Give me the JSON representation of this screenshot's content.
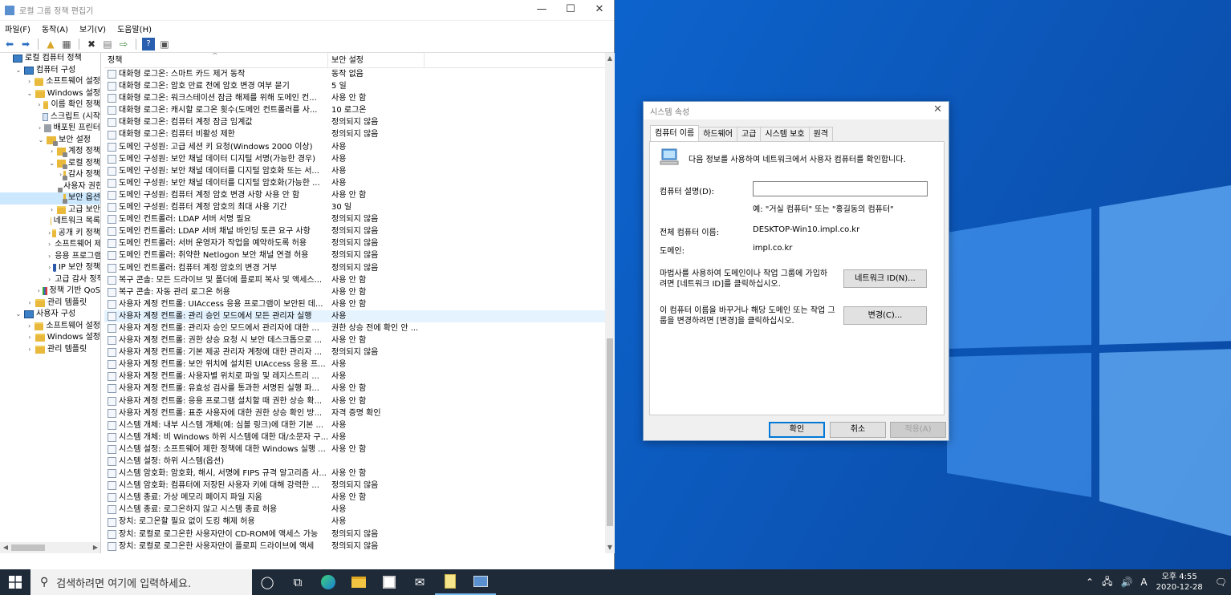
{
  "gpo": {
    "title": "로컬 그룹 정책 편집기",
    "menu": [
      "파일(F)",
      "동작(A)",
      "보기(V)",
      "도움말(H)"
    ],
    "tree": [
      {
        "label": "로컬 컴퓨터 정책",
        "level": 0,
        "exp": "",
        "icon": "pc"
      },
      {
        "label": "컴퓨터 구성",
        "level": 1,
        "exp": "⌄",
        "icon": "pc"
      },
      {
        "label": "소프트웨어 설정",
        "level": 2,
        "exp": "›",
        "icon": "folder"
      },
      {
        "label": "Windows 설정",
        "level": 2,
        "exp": "⌄",
        "icon": "folder"
      },
      {
        "label": "이름 확인 정책",
        "level": 3,
        "exp": "›",
        "icon": "folder"
      },
      {
        "label": "스크립트 (시작",
        "level": 3,
        "exp": "",
        "icon": "script"
      },
      {
        "label": "배포된 프린터",
        "level": 3,
        "exp": "›",
        "icon": "printer"
      },
      {
        "label": "보안 설정",
        "level": 3,
        "exp": "⌄",
        "icon": "sec"
      },
      {
        "label": "계정 정책",
        "level": 4,
        "exp": "›",
        "icon": "sec"
      },
      {
        "label": "로컬 정책",
        "level": 4,
        "exp": "⌄",
        "icon": "sec"
      },
      {
        "label": "감사 정책",
        "level": 5,
        "exp": "›",
        "icon": "sec"
      },
      {
        "label": "사용자 권한",
        "level": 5,
        "exp": "",
        "icon": "sec"
      },
      {
        "label": "보안 옵션",
        "level": 5,
        "exp": "",
        "icon": "sec",
        "selected": true
      },
      {
        "label": "고급 보안",
        "level": 4,
        "exp": "›",
        "icon": "folder"
      },
      {
        "label": "네트워크 목록",
        "level": 4,
        "exp": "",
        "icon": "folder"
      },
      {
        "label": "공개 키 정책",
        "level": 4,
        "exp": "›",
        "icon": "folder"
      },
      {
        "label": "소프트웨어 제한",
        "level": 4,
        "exp": "›",
        "icon": "folder"
      },
      {
        "label": "응용 프로그램",
        "level": 4,
        "exp": "›",
        "icon": "folder"
      },
      {
        "label": "IP 보안 정책",
        "level": 4,
        "exp": "›",
        "icon": "shield"
      },
      {
        "label": "고급 감사 정책",
        "level": 4,
        "exp": "›",
        "icon": "folder"
      },
      {
        "label": "정책 기반 QoS",
        "level": 3,
        "exp": "›",
        "icon": "chart"
      },
      {
        "label": "관리 템플릿",
        "level": 2,
        "exp": "›",
        "icon": "folder"
      },
      {
        "label": "사용자 구성",
        "level": 1,
        "exp": "⌄",
        "icon": "pc"
      },
      {
        "label": "소프트웨어 설정",
        "level": 2,
        "exp": "›",
        "icon": "folder"
      },
      {
        "label": "Windows 설정",
        "level": 2,
        "exp": "›",
        "icon": "folder"
      },
      {
        "label": "관리 템플릿",
        "level": 2,
        "exp": "›",
        "icon": "folder"
      }
    ],
    "columns": {
      "policy": "정책",
      "setting": "보안 설정"
    },
    "rows": [
      {
        "policy": "대화형 로그온: 스마트 카드 제거 동작",
        "setting": "동작 없음"
      },
      {
        "policy": "대화형 로그온: 암호 만료 전에 암호 변경 여부 묻기",
        "setting": "5 일"
      },
      {
        "policy": "대화형 로그온: 워크스테이션 잠금 해제를 위해 도메인 컨...",
        "setting": "사용 안 함"
      },
      {
        "policy": "대화형 로그온: 캐시할 로그온 횟수(도메인 컨트롤러를 사...",
        "setting": "10 로그온"
      },
      {
        "policy": "대화형 로그온: 컴퓨터 계정 잠금 임계값",
        "setting": "정의되지 않음"
      },
      {
        "policy": "대화형 로그온: 컴퓨터 비활성 제한",
        "setting": "정의되지 않음"
      },
      {
        "policy": "도메인 구성원: 고급 세션 키 요청(Windows 2000 이상)",
        "setting": "사용"
      },
      {
        "policy": "도메인 구성원: 보안 채널 데이터 디지털 서명(가능한 경우)",
        "setting": "사용"
      },
      {
        "policy": "도메인 구성원: 보안 채널 데이터를 디지털 암호화 또는 서...",
        "setting": "사용"
      },
      {
        "policy": "도메인 구성원: 보안 채널 데이터를 디지털 암호화(가능한 ...",
        "setting": "사용"
      },
      {
        "policy": "도메인 구성원: 컴퓨터 계정 암호 변경 사항 사용 안 함",
        "setting": "사용 안 함"
      },
      {
        "policy": "도메인 구성원: 컴퓨터 계정 암호의 최대 사용 기간",
        "setting": "30 일"
      },
      {
        "policy": "도메인 컨트롤러: LDAP 서버 서명 필요",
        "setting": "정의되지 않음"
      },
      {
        "policy": "도메인 컨트롤러: LDAP 서버 채널 바인딩 토큰 요구 사항",
        "setting": "정의되지 않음"
      },
      {
        "policy": "도메인 컨트롤러: 서버 운영자가 작업을 예약하도록 허용",
        "setting": "정의되지 않음"
      },
      {
        "policy": "도메인 컨트롤러: 취약한 Netlogon 보안 채널 연결 허용",
        "setting": "정의되지 않음"
      },
      {
        "policy": "도메인 컨트롤러: 컴퓨터 계정 암호의 변경 거부",
        "setting": "정의되지 않음"
      },
      {
        "policy": "복구 콘솔: 모든 드라이브 및 폴더에 플로피 복사 및 액세스...",
        "setting": "사용 안 함"
      },
      {
        "policy": "복구 콘솔: 자동 관리 로그온 허용",
        "setting": "사용 안 함"
      },
      {
        "policy": "사용자 계정 컨트롤: UIAccess 응용 프로그램이 보안된 데...",
        "setting": "사용 안 함"
      },
      {
        "policy": "사용자 계정 컨트롤: 관리 승인 모드에서 모든 관리자 실행",
        "setting": "사용",
        "selected": true
      },
      {
        "policy": "사용자 계정 컨트롤: 관리자 승인 모드에서 관리자에 대한 ...",
        "setting": "권한 상승 전에 확인 안 ..."
      },
      {
        "policy": "사용자 계정 컨트롤: 권한 상승 요청 시 보안 데스크톱으로 ...",
        "setting": "사용 안 함"
      },
      {
        "policy": "사용자 계정 컨트롤: 기본 제공 관리자 계정에 대한 관리자 ...",
        "setting": "정의되지 않음"
      },
      {
        "policy": "사용자 계정 컨트롤: 보안 위치에 설치된 UIAccess 응용 프...",
        "setting": "사용"
      },
      {
        "policy": "사용자 계정 컨트롤: 사용자별 위치로 파일 및 레지스트리 ...",
        "setting": "사용"
      },
      {
        "policy": "사용자 계정 컨트롤: 유효성 검사를 통과한 서명된 실행 파...",
        "setting": "사용 안 함"
      },
      {
        "policy": "사용자 계정 컨트롤: 응용 프로그램 설치할 때 권한 상승 확...",
        "setting": "사용 안 함"
      },
      {
        "policy": "사용자 계정 컨트롤: 표준 사용자에 대한 권한 상승 확인 방...",
        "setting": "자격 증명 확인"
      },
      {
        "policy": "시스템 개체: 내부 시스템 개체(예: 심볼 링크)에 대한 기본 ...",
        "setting": "사용"
      },
      {
        "policy": "시스템 개체: 비 Windows 하위 시스템에 대한 대/소문자 구...",
        "setting": "사용"
      },
      {
        "policy": "시스템 설정: 소프트웨어 제한 정책에 대한 Windows 실행 ...",
        "setting": "사용 안 함"
      },
      {
        "policy": "시스템 설정: 하위 시스템(옵션)",
        "setting": ""
      },
      {
        "policy": "시스템 암호화: 암호화, 해시, 서명에 FIPS 규격 알고리즘 사...",
        "setting": "사용 안 함"
      },
      {
        "policy": "시스템 암호화: 컴퓨터에 저장된 사용자 키에 대해 강력한 ...",
        "setting": "정의되지 않음"
      },
      {
        "policy": "시스템 종료: 가상 메모리 페이지 파일 지움",
        "setting": "사용 안 함"
      },
      {
        "policy": "시스템 종료: 로그온하지 않고 시스템 종료 허용",
        "setting": "사용"
      },
      {
        "policy": "장치: 로그온할 필요 없이 도킹 해제 허용",
        "setting": "사용"
      },
      {
        "policy": "장치: 로컬로 로그온한 사용자만이 CD-ROM에 액세스 가능",
        "setting": "정의되지 않음"
      },
      {
        "policy": "장치: 로컬로 로그온한 사용자만이 플로피 드라이브에 액세",
        "setting": "정의되지 않음"
      }
    ]
  },
  "sysprop": {
    "title": "시스템 속성",
    "tabs": [
      "컴퓨터 이름",
      "하드웨어",
      "고급",
      "시스템 보호",
      "원격"
    ],
    "intro": "다음 정보를 사용하여 네트워크에서 사용자 컴퓨터를 확인합니다.",
    "desc_label": "컴퓨터 설명(D):",
    "desc_value": "",
    "example": "예: \"거실 컴퓨터\" 또는 \"홍길동의 컴퓨터\"",
    "fullname_label": "전체 컴퓨터 이름:",
    "fullname_value": "DESKTOP-Win10.impl.co.kr",
    "domain_label": "도메인:",
    "domain_value": "impl.co.kr",
    "wizard_text": "마법사를 사용하여 도메인이나 작업 그룹에 가입하려면 [네트워크 ID]를 클릭하십시오.",
    "network_id_btn": "네트워크 ID(N)...",
    "rename_text": "이 컴퓨터 이름을 바꾸거나 해당 도메인 또는 작업 그룹을 변경하려면 [변경]을 클릭하십시오.",
    "change_btn": "변경(C)...",
    "ok_btn": "확인",
    "cancel_btn": "취소",
    "apply_btn": "적용(A)"
  },
  "taskbar": {
    "search_placeholder": "검색하려면 여기에 입력하세요.",
    "time": "오후 4:55",
    "date": "2020-12-28",
    "ime": "A"
  },
  "colors": {
    "taskbar": "#1e2a38",
    "desktop": "#0b55b8",
    "accent": "#0078d7"
  }
}
